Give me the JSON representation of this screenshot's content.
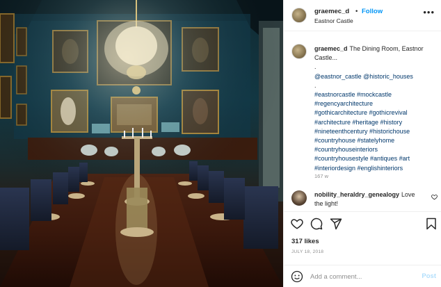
{
  "header": {
    "username": "graemec_d",
    "dot": "•",
    "follow_label": "Follow",
    "location": "Eastnor Castle",
    "more_label": "•••"
  },
  "caption": {
    "username": "graemec_d",
    "lines": [
      "The Dining Room, Eastnor",
      "Castle...",
      ".",
      "@eastnor_castle @historic_houses",
      ".",
      "#eastnorcastle #mockcastle",
      "#regencyarchitecture",
      "#gothicarchitecture #gothicrevival",
      "#architecture #heritage #history",
      "#nineteenthcentury #historichouse",
      "#countryhouse #statelyhome",
      "#countryhouseinteriors",
      "#countryhousestyle #antiques #art",
      "#interiordesign #englishinteriors"
    ],
    "time": "167 w"
  },
  "comment": {
    "username": "nobility_heraldry_genealogy",
    "text": "Love the light!"
  },
  "actions": {
    "like_icon": "heart-icon",
    "comment_icon": "comment-icon",
    "share_icon": "share-icon",
    "save_icon": "bookmark-icon"
  },
  "likes": "317 likes",
  "date": "JULY 18, 2018",
  "add_comment": {
    "placeholder": "Add a comment...",
    "post_label": "Post"
  },
  "colors": {
    "link": "#00376b",
    "follow": "#0095f6",
    "post_disabled": "#b2dffc",
    "muted": "#8e8e8e",
    "text": "#262626"
  }
}
